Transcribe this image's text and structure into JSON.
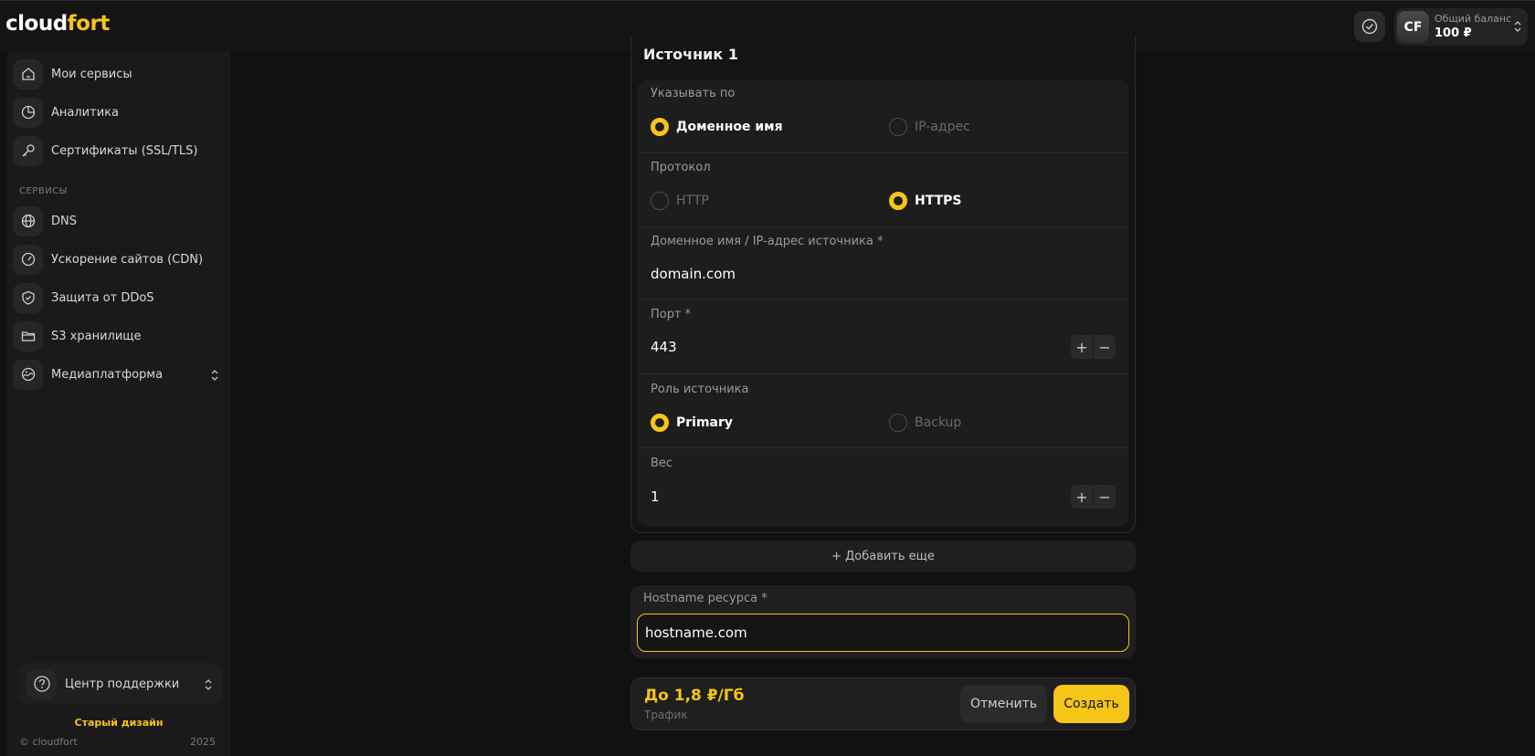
{
  "header": {
    "logo_part1": "cloud",
    "logo_part2": "fort",
    "avatar_initials": "CF",
    "balance_label": "Общий баланс",
    "balance_value": "100 ₽"
  },
  "sidebar": {
    "items": [
      {
        "label": "Мои сервисы",
        "icon": "home-icon"
      },
      {
        "label": "Аналитика",
        "icon": "pie-chart-icon"
      },
      {
        "label": "Сертификаты (SSL/TLS)",
        "icon": "key-icon"
      }
    ],
    "section_title": "СЕРВИСЫ",
    "services": [
      {
        "label": "DNS",
        "icon": "globe-icon"
      },
      {
        "label": "Ускорение сайтов (CDN)",
        "icon": "speedometer-icon"
      },
      {
        "label": "Защита от DDoS",
        "icon": "shield-icon"
      },
      {
        "label": "S3 хранилище",
        "icon": "folder-icon"
      },
      {
        "label": "Медиаплатформа",
        "icon": "media-icon"
      }
    ],
    "support_label": "Центр поддержки",
    "old_design": "Старый дизайн",
    "copyright": "© cloudfort",
    "year": "2025"
  },
  "source": {
    "title": "Источник 1",
    "specify_by_label": "Указывать по",
    "specify_options": [
      "Доменное имя",
      "IP-адрес"
    ],
    "specify_selected": "Доменное имя",
    "protocol_label": "Протокол",
    "protocol_options": [
      "HTTP",
      "HTTPS"
    ],
    "protocol_selected": "HTTPS",
    "origin_label": "Доменное имя / IP-адрес источника *",
    "origin_value": "domain.com",
    "port_label": "Порт *",
    "port_value": "443",
    "role_label": "Роль источника",
    "role_options": [
      "Primary",
      "Backup"
    ],
    "role_selected": "Primary",
    "weight_label": "Вес",
    "weight_value": "1",
    "plus": "+",
    "minus": "−"
  },
  "add_more": "+ Добавить еще",
  "hostname": {
    "label": "Hostname ресурса *",
    "value": "hostname.com"
  },
  "footer": {
    "price": "До 1,8 ₽/Гб",
    "price_sub": "Трафик",
    "cancel": "Отменить",
    "create": "Создать"
  },
  "colors": {
    "accent": "#f5c518",
    "background": "#111111",
    "panel": "#1d1d1d"
  }
}
